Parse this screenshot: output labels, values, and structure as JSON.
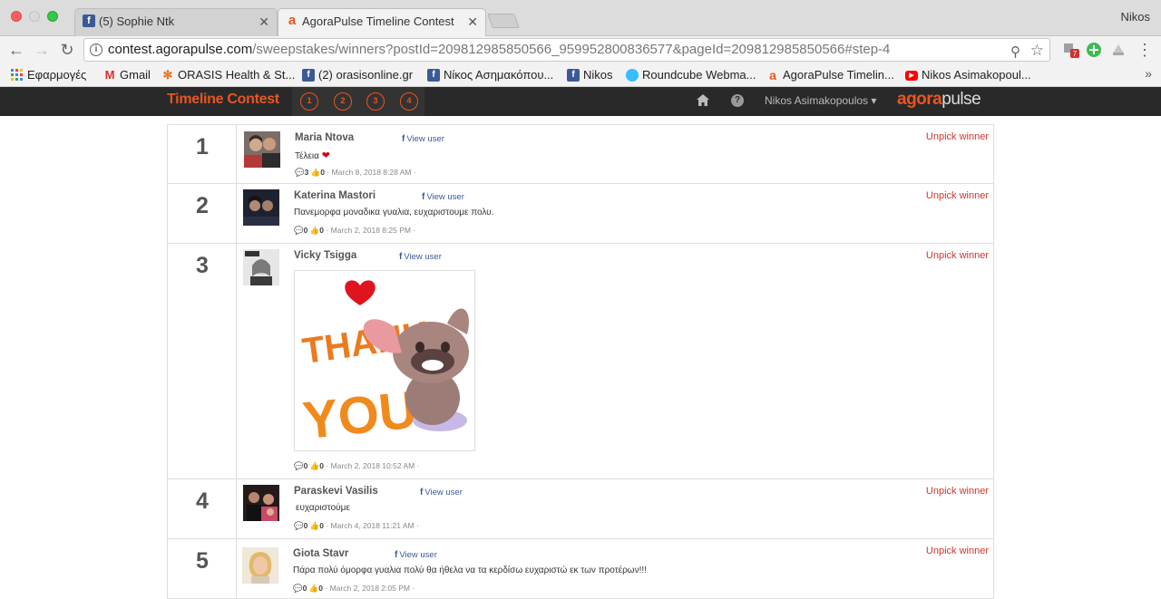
{
  "browser": {
    "tabs": [
      {
        "title": "(5) Sophie Ntk"
      },
      {
        "title": "AgoraPulse Timeline Contest -"
      }
    ],
    "profile": "Nikos",
    "url_host": "contest.agorapulse.com",
    "url_path": "/sweepstakes/winners?postId=209812985850566_959952800836577&pageId=209812985850566#step-4",
    "extension_badge": "7"
  },
  "bookmarks": [
    {
      "label": "Εφαρμογές",
      "icon": "apps-grid-icon"
    },
    {
      "label": "Gmail",
      "icon": "gmail-icon"
    },
    {
      "label": "ORASIS Health & St...",
      "icon": "joomla-icon"
    },
    {
      "label": "(2) orasisonline.gr",
      "icon": "facebook-icon"
    },
    {
      "label": "Νίκος Ασημακόπου...",
      "icon": "facebook-icon"
    },
    {
      "label": "Nikos",
      "icon": "facebook-icon"
    },
    {
      "label": "Roundcube Webma...",
      "icon": "roundcube-icon"
    },
    {
      "label": "AgoraPulse Timelin...",
      "icon": "agorapulse-icon"
    },
    {
      "label": "Nikos Asimakopoul...",
      "icon": "youtube-icon"
    }
  ],
  "app": {
    "brand": "Timeline Contest",
    "steps": [
      "1",
      "2",
      "3",
      "4"
    ],
    "user_menu": "Nikos Asimakopoulos ▾",
    "logo_a": "agora",
    "logo_b": "pulse",
    "colors": {
      "accent": "#ea5521",
      "header_bg": "#292929",
      "link": "#3b5998",
      "unpick": "#d0352b"
    }
  },
  "winners": [
    {
      "rank": "1",
      "name": "Maria Ntova",
      "view": "View user",
      "comment": "Τέλεια",
      "comments": "3",
      "likes": "0",
      "date": "March 8, 2018 8:28 AM",
      "unpick": "Unpick winner"
    },
    {
      "rank": "2",
      "name": "Katerina Mastori",
      "view": "View user",
      "comment": "Πανεμορφα μοναδικα γυαλια, ευχαριστουμε πολυ.",
      "comments": "0",
      "likes": "0",
      "date": "March 2, 2018 8:25 PM",
      "unpick": "Unpick winner"
    },
    {
      "rank": "3",
      "name": "Vicky Tsigga",
      "view": "View user",
      "sticker_text_1": "THANK",
      "sticker_text_2": "YOU!",
      "comments": "0",
      "likes": "0",
      "date": "March 2, 2018 10:52 AM",
      "unpick": "Unpick winner"
    },
    {
      "rank": "4",
      "name": "Paraskevi Vasilis",
      "view": "View user",
      "comment": "ευχαριστούμε",
      "comments": "0",
      "likes": "0",
      "date": "March 4, 2018 11:21 AM",
      "unpick": "Unpick winner"
    },
    {
      "rank": "5",
      "name": "Giota Stavr",
      "view": "View user",
      "comment": "Πάρα πολύ όμορφα γυαλια πολύ θα ήθελα να τα κερδίσω ευχαριστώ εκ των προτέρων!!!",
      "comments": "0",
      "likes": "0",
      "date": "March 2, 2018 2:05 PM",
      "unpick": "Unpick winner"
    }
  ]
}
